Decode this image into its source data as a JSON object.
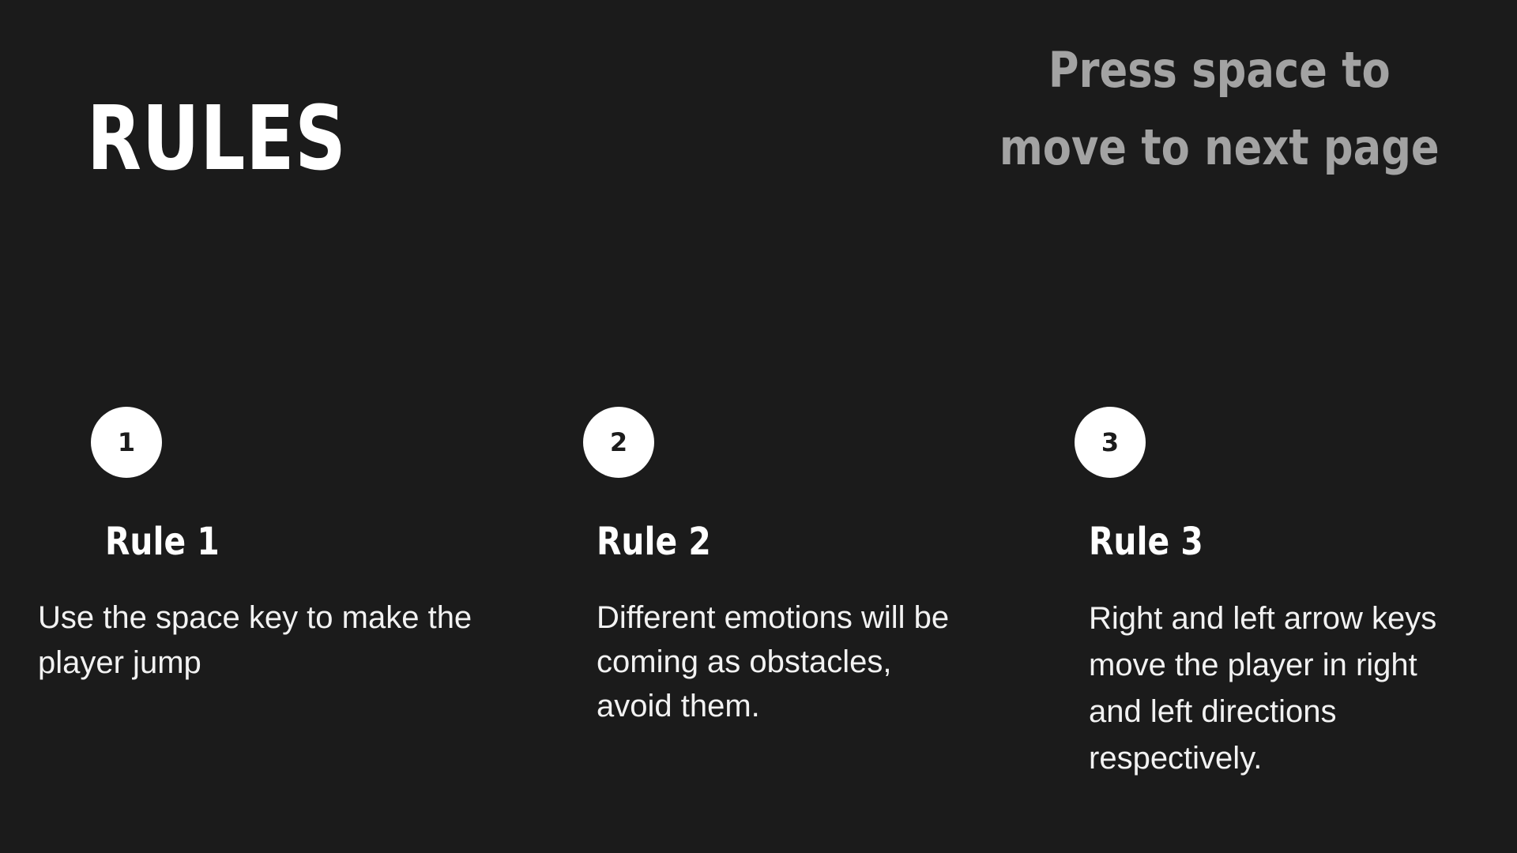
{
  "page": {
    "title": "RULES",
    "hint": "Press space to move to next page"
  },
  "rules": [
    {
      "number": "1",
      "title": "Rule 1",
      "text": "Use the space key to make the player jump"
    },
    {
      "number": "2",
      "title": "Rule 2",
      "text": "Different emotions will be coming as obstacles, avoid them."
    },
    {
      "number": "3",
      "title": "Rule 3",
      "text": "Right and left arrow keys move the player in right and left directions respectively."
    }
  ],
  "colors": {
    "background": "#1b1b1b",
    "title": "#ffffff",
    "hint": "#a3a3a3",
    "circle": "#ffffff",
    "body_text": "#f2f2f2"
  }
}
